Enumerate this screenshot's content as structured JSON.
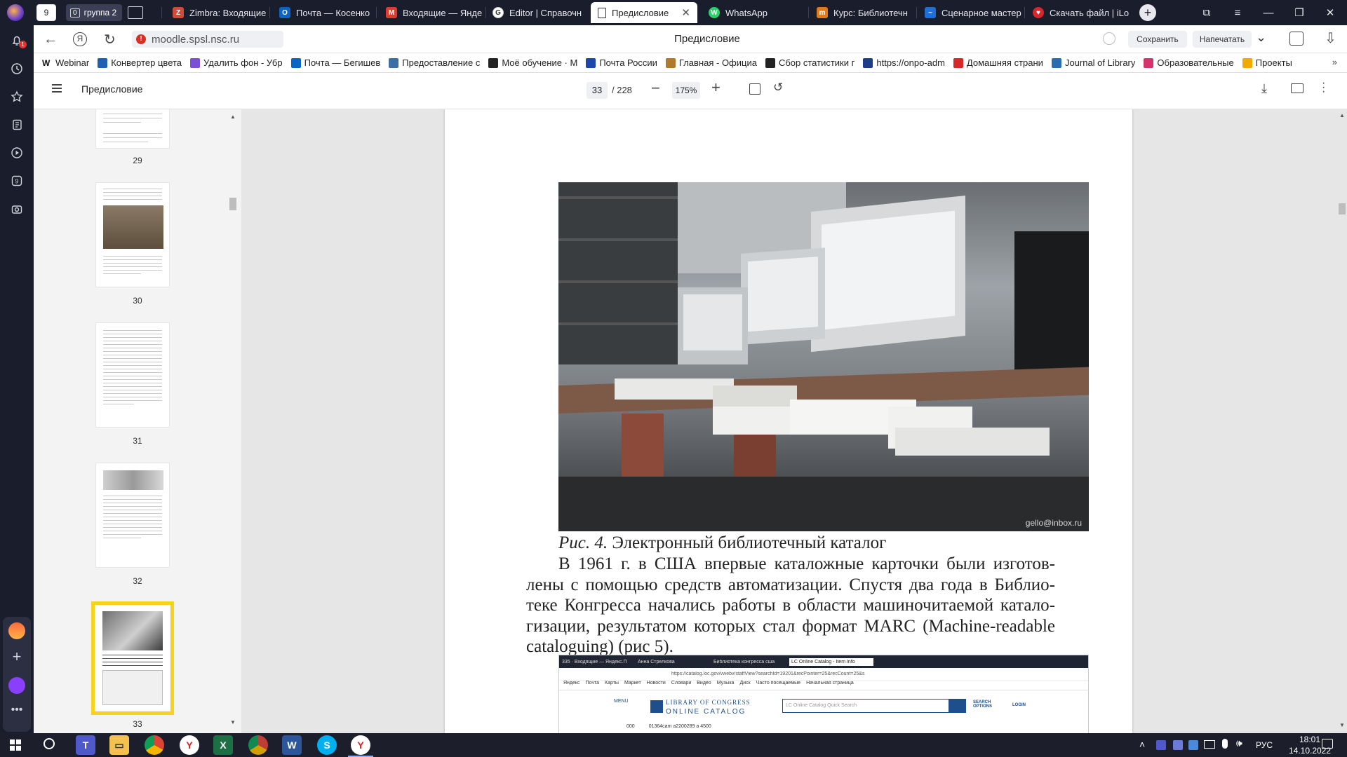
{
  "tabs": [
    {
      "label": "9",
      "kind": "workspace"
    },
    {
      "label": "группа 2",
      "count": "0",
      "kind": "group"
    },
    {
      "label": "Zimbra: Входящие",
      "color": "#d24a3a",
      "glyph": "Z"
    },
    {
      "label": "Почта — Косенко",
      "color": "#0a64c4",
      "glyph": "O"
    },
    {
      "label": "Входящие — Янде",
      "color": "#e03b2e",
      "glyph": "M"
    },
    {
      "label": "Editor | Справочн",
      "color": "#555555",
      "glyph": "G"
    },
    {
      "label": "Предисловие",
      "active": true,
      "glyph": "□"
    },
    {
      "label": "WhatsApp",
      "color": "#25d366",
      "glyph": "W"
    },
    {
      "label": "Курс: Библиотечн",
      "color": "#e07b1c",
      "glyph": "m"
    },
    {
      "label": "Сценарное мастер",
      "color": "#1e6fd6",
      "glyph": "~"
    },
    {
      "label": "Скачать файл | iLo",
      "color": "#d8262c",
      "glyph": "♥"
    }
  ],
  "sidebar_icons": [
    "bell-icon",
    "clock-icon",
    "star-icon",
    "notes-icon",
    "play-icon",
    "number-icon",
    "camera-icon"
  ],
  "sidebar_badge": "1",
  "address": {
    "url": "moodle.spsl.nsc.ru",
    "page_title": "Предисловие",
    "save_label": "Сохранить",
    "print_label": "Напечатать"
  },
  "bookmarks": [
    {
      "label": "Webinar",
      "color": "#111111",
      "glyph": "W"
    },
    {
      "label": "Конвертер цвета",
      "color": "#1e5fb3"
    },
    {
      "label": "Удалить фон - Убр",
      "color": "#7a4fd6"
    },
    {
      "label": "Почта — Бегишев",
      "color": "#0a64c4"
    },
    {
      "label": "Предоставление с",
      "color": "#3a6ea5"
    },
    {
      "label": "Моё обучение · М",
      "color": "#222222"
    },
    {
      "label": "Почта России",
      "color": "#1a47a8"
    },
    {
      "label": "Главная - Официа",
      "color": "#b07a2a"
    },
    {
      "label": "Сбор статистики г",
      "color": "#222222"
    },
    {
      "label": "https://onpo-adm",
      "color": "#1d3c8a"
    },
    {
      "label": "Домашняя страни",
      "color": "#d62828"
    },
    {
      "label": "Journal of Library",
      "color": "#2b6cb0"
    },
    {
      "label": "Образовательные",
      "color": "#d6336c"
    },
    {
      "label": "Проекты",
      "color": "#f2a900"
    }
  ],
  "pdf": {
    "title": "Предисловие",
    "current_page": "33",
    "total_pages": "/ 228",
    "zoom": "175%"
  },
  "thumbnails": [
    {
      "page": "29",
      "kind": "text"
    },
    {
      "page": "30",
      "kind": "photo"
    },
    {
      "page": "31",
      "kind": "text"
    },
    {
      "page": "32",
      "kind": "devices"
    },
    {
      "page": "33",
      "kind": "current",
      "selected": true
    }
  ],
  "document": {
    "photo_watermark": "gello@inbox.ru",
    "caption_label": "Рис. 4.",
    "caption_text": " Электронный библиотечный каталог",
    "paragraph": [
      "В 1961 г. в США впервые каталожные карточки были изготов-",
      "лены с помощью средств автоматизации. Спустя два года в Библио-",
      "теке Конгресса начались работы в области машиночитаемой катало-",
      "гизации, результатом которых стал формат MARC (Machine-readable",
      "cataloguing) (рис 5)."
    ],
    "loc_logo_line1": "LIBRARY OF CONGRESS",
    "loc_logo_line2": "ONLINE CATALOG",
    "loc_search_placeholder": "LC Online Catalog Quick Search",
    "loc_search_options": "SEARCH OPTIONS",
    "loc_login": "LOGIN",
    "loc_menu": "MENU",
    "loc_tabs": [
      "335 · Входящие — Яндекс.П",
      "Анна Стрелкова",
      "Библиотека конгресса сша",
      "LC Online Catalog - Item Info"
    ],
    "loc_url": "https://catalog.loc.gov/vwebv/staffView?searchId=19201&recPointer=25&recCount=25&s",
    "loc_bookmarks": [
      "Яндекс",
      "Почта",
      "Карты",
      "Маркет",
      "Новости",
      "Словари",
      "Видео",
      "Музыка",
      "Диск",
      "Часто посещаемые",
      "Начальная страница"
    ],
    "loc_row": [
      "000",
      "01364cam a2200289 a 4500"
    ]
  },
  "taskbar": {
    "lang": "РУС",
    "time": "18:01",
    "date": "14.10.2022"
  }
}
